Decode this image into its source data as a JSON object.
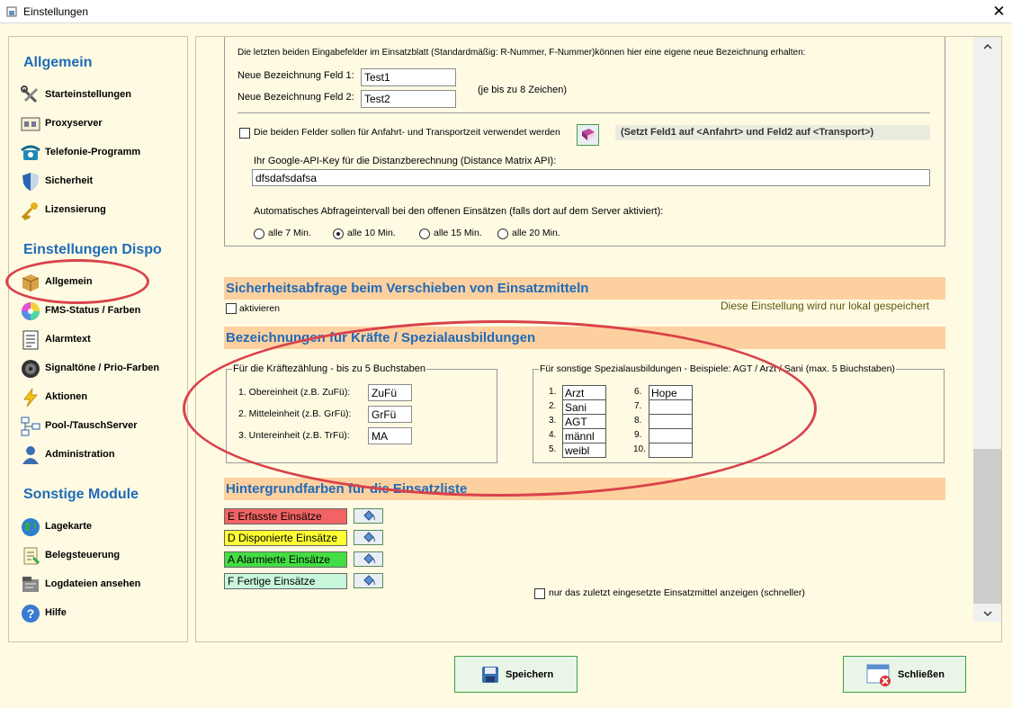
{
  "window": {
    "title": "Einstellungen",
    "close_glyph": "✕"
  },
  "sidebar": {
    "sections": [
      {
        "title": "Allgemein",
        "items": [
          {
            "label": "Starteinstellungen",
            "icon": "tools-icon"
          },
          {
            "label": "Proxyserver",
            "icon": "proxy-icon"
          },
          {
            "label": "Telefonie-Programm",
            "icon": "phone-icon"
          },
          {
            "label": "Sicherheit",
            "icon": "shield-icon"
          },
          {
            "label": "Lizensierung",
            "icon": "key-icon"
          }
        ]
      },
      {
        "title": "Einstellungen Dispo",
        "items": [
          {
            "label": "Allgemein",
            "icon": "box-icon"
          },
          {
            "label": "FMS-Status / Farben",
            "icon": "color-wheel-icon"
          },
          {
            "label": "Alarmtext",
            "icon": "document-icon"
          },
          {
            "label": "Signaltöne / Prio-Farben",
            "icon": "speaker-icon"
          },
          {
            "label": "Aktionen",
            "icon": "lightning-icon"
          },
          {
            "label": "Pool-/TauschServer",
            "icon": "network-icon"
          },
          {
            "label": "Administration",
            "icon": "user-icon"
          }
        ]
      },
      {
        "title": "Sonstige Module",
        "items": [
          {
            "label": "Lagekarte",
            "icon": "globe-icon"
          },
          {
            "label": "Belegsteuerung",
            "icon": "receipt-icon"
          },
          {
            "label": "Logdateien ansehen",
            "icon": "log-icon"
          },
          {
            "label": "Hilfe",
            "icon": "help-icon"
          }
        ]
      }
    ]
  },
  "main": {
    "fields_intro": "Die letzten beiden Eingabefelder im Einsatzblatt  (Standardmäßig: R-Nummer, F-Nummer)können hier eine eigene neue Bezeichnung erhalten:",
    "field1_label": "Neue Bezeichnung Feld 1:",
    "field1_value": "Test1",
    "field2_label": "Neue Bezeichnung Feld 2:",
    "field2_value": "Test2",
    "max_chars_hint": "(je bis zu 8 Zeichen)",
    "transport_checkbox_label": "Die beiden Felder sollen für Anfahrt- und Transportzeit verwendet werden",
    "transport_checked": false,
    "transport_hint": "(Setzt Feld1 auf <Anfahrt> und Feld2 auf <Transport>)",
    "api_key_label": "Ihr Google-API-Key für die Distanzberechnung (Distance Matrix API):",
    "api_key_value": "dfsdafsdafsa",
    "interval_label": "Automatisches Abfrageintervall bei den offenen Einsätzen (falls dort auf dem Server aktiviert):",
    "interval_options": [
      "alle 7 Min.",
      "alle 10 Min.",
      "alle 15 Min.",
      "alle 20 Min."
    ],
    "interval_selected": "alle 10 Min.",
    "security_section": {
      "title": "Sicherheitsabfrage beim Verschieben von Einsatzmitteln",
      "checkbox_label": "aktivieren",
      "checked": false,
      "local_note": "Diese Einstellung wird nur lokal gespeichert"
    },
    "labels_section": {
      "title": "Bezeichnungen für Kräfte / Spezialausbildungen",
      "forces_group": {
        "legend": "Für die Kräftezählung - bis zu 5 Buchstaben",
        "rows": [
          {
            "label": "1. Obereinheit (z.B. ZuFü):",
            "value": "ZuFü"
          },
          {
            "label": "2. Mitteleinheit (z.B. GrFü):",
            "value": "GrFü"
          },
          {
            "label": "3. Untereinheit (z.B. TrFü):",
            "value": "MA"
          }
        ]
      },
      "special_group": {
        "legend": "Für sonstige Spezialausbildungen - Beispiele: AGT / Arzt / Sani (max. 5 Biuchstaben)",
        "left": [
          {
            "num": "1.",
            "value": "Arzt"
          },
          {
            "num": "2.",
            "value": "Sani"
          },
          {
            "num": "3.",
            "value": "AGT"
          },
          {
            "num": "4.",
            "value": "männl"
          },
          {
            "num": "5.",
            "value": "weibl"
          }
        ],
        "right": [
          {
            "num": "6.",
            "value": "Hope"
          },
          {
            "num": "7.",
            "value": ""
          },
          {
            "num": "8.",
            "value": ""
          },
          {
            "num": "9.",
            "value": ""
          },
          {
            "num": "10.",
            "value": ""
          }
        ]
      }
    },
    "colors_section": {
      "title": "Hintergrundfarben für die Einsatzliste",
      "items": [
        {
          "label": "E Erfasste Einsätze",
          "color": "#f26464"
        },
        {
          "label": "D Disponierte Einsätze",
          "color": "#ffff33"
        },
        {
          "label": "A Alarmierte Einsätze",
          "color": "#44dd44"
        },
        {
          "label": "F Fertige Einsätze",
          "color": "#c8f7dc"
        }
      ],
      "last_unit_checkbox_label": "nur das zuletzt eingesetzte Einsatzmittel anzeigen (schneller)",
      "last_unit_checked": false
    }
  },
  "buttons": {
    "save_label": "Speichern",
    "close_label": "Schließen"
  },
  "annotation_color": "#d9424a"
}
